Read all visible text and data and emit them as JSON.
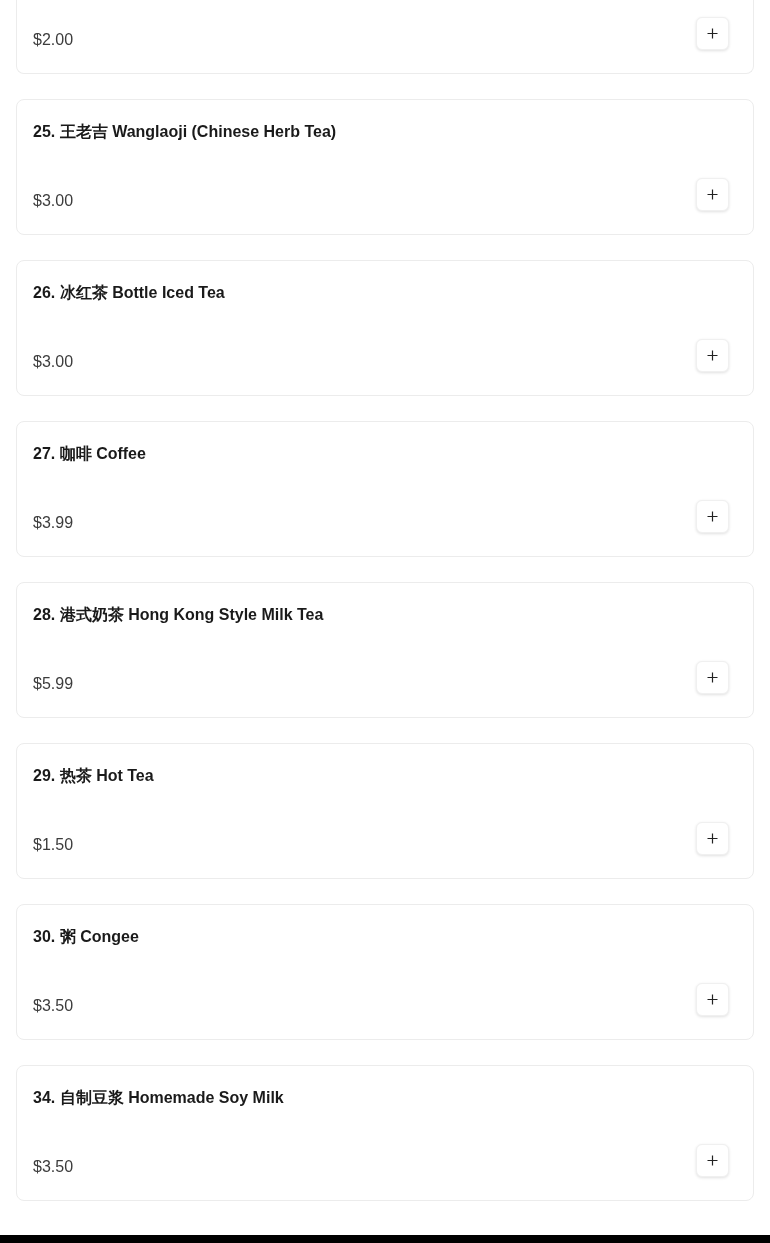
{
  "items": [
    {
      "kind": "partial",
      "price": "$2.00"
    },
    {
      "kind": "full",
      "name": "25. 王老吉 Wanglaoji (Chinese Herb Tea)",
      "price": "$3.00"
    },
    {
      "kind": "full",
      "name": "26. 冰红茶 Bottle Iced Tea",
      "price": "$3.00"
    },
    {
      "kind": "full",
      "name": "27. 咖啡 Coffee",
      "price": "$3.99"
    },
    {
      "kind": "full",
      "name": "28. 港式奶茶 Hong Kong Style Milk Tea",
      "price": "$5.99"
    },
    {
      "kind": "full",
      "name": "29. 热茶 Hot Tea",
      "price": "$1.50"
    },
    {
      "kind": "full",
      "name": "30. 粥 Congee",
      "price": "$3.50"
    },
    {
      "kind": "full",
      "name": "34. 自制豆浆 Homemade Soy Milk",
      "price": "$3.50"
    }
  ]
}
